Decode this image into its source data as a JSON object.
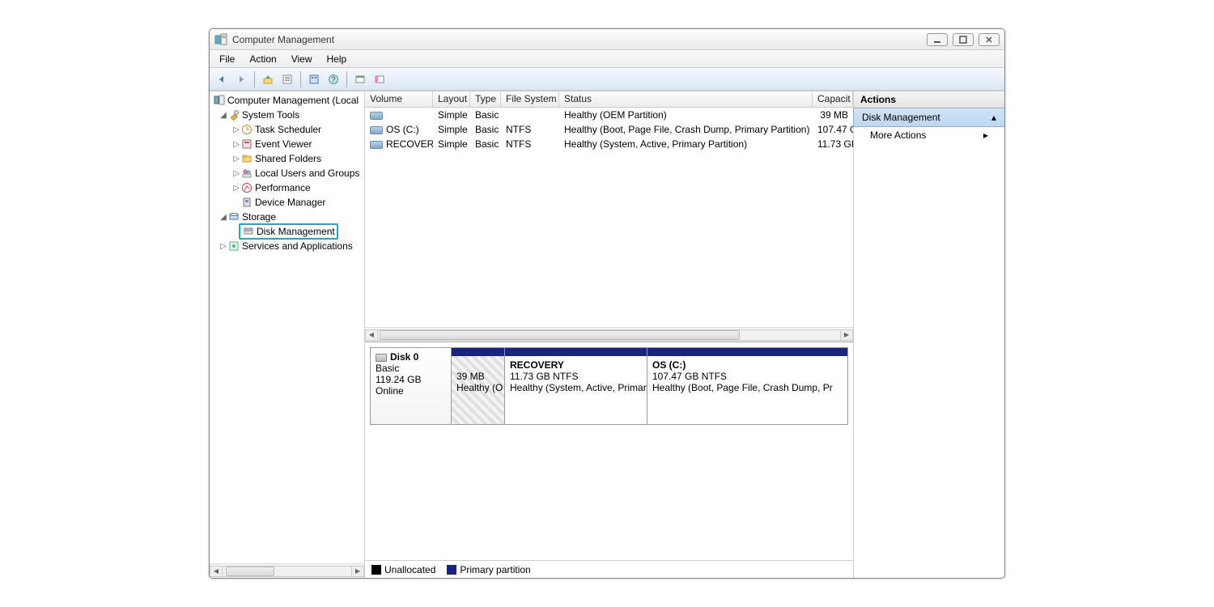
{
  "window": {
    "title": "Computer Management"
  },
  "menu": {
    "items": [
      "File",
      "Action",
      "View",
      "Help"
    ]
  },
  "tree": {
    "root": "Computer Management (Local",
    "system_tools": "System Tools",
    "task_scheduler": "Task Scheduler",
    "event_viewer": "Event Viewer",
    "shared_folders": "Shared Folders",
    "local_users": "Local Users and Groups",
    "performance": "Performance",
    "device_manager": "Device Manager",
    "storage": "Storage",
    "disk_management": "Disk Management",
    "services": "Services and Applications"
  },
  "table": {
    "headers": {
      "volume": "Volume",
      "layout": "Layout",
      "type": "Type",
      "fs": "File System",
      "status": "Status",
      "capacity": "Capacit"
    },
    "rows": [
      {
        "vol": "",
        "layout": "Simple",
        "type": "Basic",
        "fs": "",
        "status": "Healthy (OEM Partition)",
        "cap": "39 MB"
      },
      {
        "vol": "OS (C:)",
        "layout": "Simple",
        "type": "Basic",
        "fs": "NTFS",
        "status": "Healthy (Boot, Page File, Crash Dump, Primary Partition)",
        "cap": "107.47 G"
      },
      {
        "vol": "RECOVERY",
        "layout": "Simple",
        "type": "Basic",
        "fs": "NTFS",
        "status": "Healthy (System, Active, Primary Partition)",
        "cap": "11.73 GI"
      }
    ]
  },
  "disk": {
    "name": "Disk 0",
    "type": "Basic",
    "size": "119.24 GB",
    "status": "Online",
    "parts": [
      {
        "title": "",
        "line1": "39 MB",
        "line2": "Healthy (O"
      },
      {
        "title": "RECOVERY",
        "line1": "11.73 GB NTFS",
        "line2": "Healthy (System, Active, Primary"
      },
      {
        "title": "OS  (C:)",
        "line1": "107.47 GB NTFS",
        "line2": "Healthy (Boot, Page File, Crash Dump, Pr"
      }
    ]
  },
  "legend": {
    "unalloc": "Unallocated",
    "primary": "Primary partition"
  },
  "actions": {
    "title": "Actions",
    "dm": "Disk Management",
    "more": "More Actions"
  }
}
